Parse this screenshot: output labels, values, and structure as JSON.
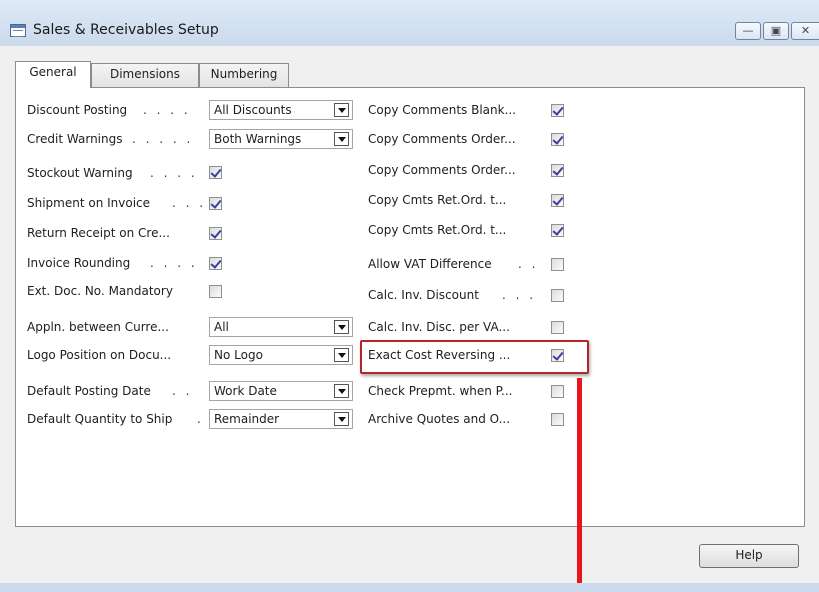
{
  "window": {
    "title": "Sales & Receivables Setup",
    "controls": {
      "minimize": "—",
      "maximize": "▣",
      "close": "✕"
    }
  },
  "tabs": [
    {
      "label": "General",
      "active": true
    },
    {
      "label": "Dimensions",
      "active": false
    },
    {
      "label": "Numbering",
      "active": false
    }
  ],
  "left_fields": {
    "discount_posting": {
      "label": "Discount Posting",
      "dots": ". . . .",
      "value": "All Discounts"
    },
    "credit_warnings": {
      "label": "Credit Warnings",
      "dots": ". . . . .",
      "value": "Both Warnings"
    },
    "stockout_warning": {
      "label": "Stockout Warning",
      "dots": ". . . .",
      "checked": true
    },
    "shipment_on_invoice": {
      "label": "Shipment on Invoice",
      "dots": ". . .",
      "checked": true
    },
    "return_receipt": {
      "label": "Return Receipt on Cre...",
      "checked": true
    },
    "invoice_rounding": {
      "label": "Invoice Rounding",
      "dots": ". . . .",
      "checked": true
    },
    "ext_doc_no": {
      "label": "Ext. Doc. No. Mandatory",
      "checked": false
    },
    "appln_between": {
      "label": "Appln. between Curre...",
      "value": "All"
    },
    "logo_position": {
      "label": "Logo Position on Docu...",
      "value": "No Logo"
    },
    "default_posting_date": {
      "label": "Default Posting Date",
      "dots": ". .",
      "value": "Work Date"
    },
    "default_qty_ship": {
      "label": "Default Quantity to Ship",
      "dots": ".",
      "value": "Remainder"
    }
  },
  "right_fields": {
    "copy_comments_blank": {
      "label": "Copy Comments Blank...",
      "checked": true
    },
    "copy_comments_order_1": {
      "label": "Copy Comments Order...",
      "checked": true
    },
    "copy_comments_order_2": {
      "label": "Copy Comments Order...",
      "checked": true
    },
    "copy_cmts_ret_1": {
      "label": "Copy Cmts Ret.Ord. t...",
      "checked": true
    },
    "copy_cmts_ret_2": {
      "label": "Copy Cmts Ret.Ord. t...",
      "checked": true
    },
    "allow_vat_difference": {
      "label": "Allow VAT Difference",
      "dots": ". .",
      "checked": false
    },
    "calc_inv_discount": {
      "label": "Calc. Inv. Discount",
      "dots": ". . .",
      "checked": false
    },
    "calc_inv_disc_per_vat": {
      "label": "Calc. Inv. Disc. per VA...",
      "checked": false
    },
    "exact_cost_reversing": {
      "label": "Exact Cost Reversing ...",
      "checked": true
    },
    "check_prepmt": {
      "label": "Check Prepmt. when P...",
      "checked": false
    },
    "archive_quotes": {
      "label": "Archive Quotes and O...",
      "checked": false
    }
  },
  "buttons": {
    "help": "Help"
  },
  "colors": {
    "highlight_border": "#b3262b",
    "pointer_line": "#e8161b",
    "titlebar": "#d2e0f0"
  }
}
